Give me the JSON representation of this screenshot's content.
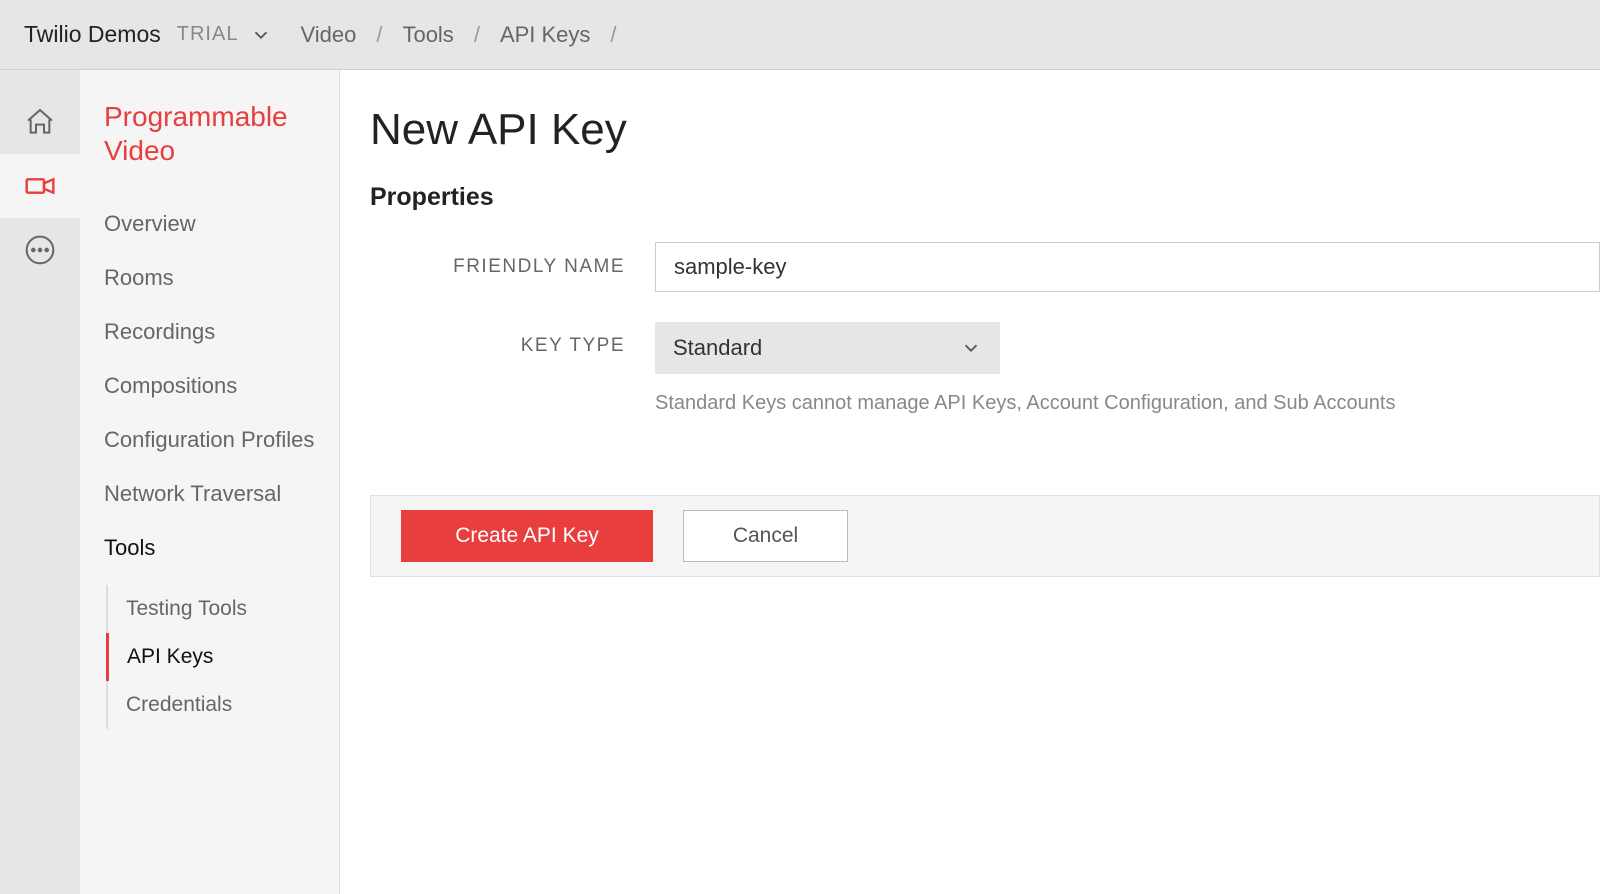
{
  "header": {
    "accountName": "Twilio Demos",
    "trialBadge": "TRIAL",
    "breadcrumbs": [
      "Video",
      "Tools",
      "API Keys",
      ""
    ]
  },
  "rail": {
    "home": "home-icon",
    "video": "video-icon",
    "more": "more-icon"
  },
  "sidebar": {
    "title": "Programmable Video",
    "items": [
      {
        "label": "Overview"
      },
      {
        "label": "Rooms"
      },
      {
        "label": "Recordings"
      },
      {
        "label": "Compositions"
      },
      {
        "label": "Configuration Profiles"
      },
      {
        "label": "Network Traversal"
      },
      {
        "label": "Tools",
        "activeParent": true
      }
    ],
    "subItems": [
      {
        "label": "Testing Tools"
      },
      {
        "label": "API Keys",
        "active": true
      },
      {
        "label": "Credentials"
      }
    ]
  },
  "main": {
    "pageTitle": "New API Key",
    "sectionTitle": "Properties",
    "friendlyNameLabel": "FRIENDLY NAME",
    "friendlyNameValue": "sample-key",
    "keyTypeLabel": "KEY TYPE",
    "keyTypeValue": "Standard",
    "helperText": "Standard Keys cannot manage API Keys, Account Configuration, and Sub Accounts",
    "createButton": "Create API Key",
    "cancelButton": "Cancel"
  }
}
